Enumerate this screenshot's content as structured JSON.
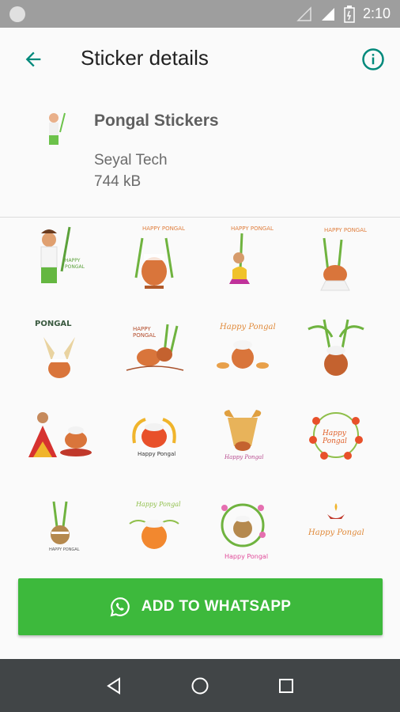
{
  "status_bar": {
    "time": "2:10"
  },
  "app_bar": {
    "title": "Sticker details",
    "back_icon": "arrow-back-icon",
    "info_icon": "info-icon"
  },
  "pack": {
    "name": "Pongal Stickers",
    "publisher": "Seyal Tech",
    "size": "744 kB"
  },
  "stickers": [
    {
      "caption": ""
    },
    {
      "caption": "HAPPY PONGAL"
    },
    {
      "caption": "HAPPY PONGAL"
    },
    {
      "caption": "HAPPY PONGAL"
    },
    {
      "caption": "PONGAL"
    },
    {
      "caption": "HAPPY PONGAL"
    },
    {
      "caption": "Happy Pongal"
    },
    {
      "caption": ""
    },
    {
      "caption": ""
    },
    {
      "caption": "Happy Pongal"
    },
    {
      "caption": "Happy Pongal"
    },
    {
      "caption": "Happy Pongal"
    },
    {
      "caption": "HAPPY PONGAL"
    },
    {
      "caption": "Happy Pongal"
    },
    {
      "caption": "Happy Pongal"
    },
    {
      "caption": "Happy Pongal"
    }
  ],
  "cta": {
    "label": "ADD TO WHATSAPP",
    "icon": "whatsapp-icon"
  },
  "colors": {
    "accent": "#00897b",
    "cta": "#3db93c",
    "navbar": "#414547",
    "statusbar": "#9e9e9e"
  }
}
